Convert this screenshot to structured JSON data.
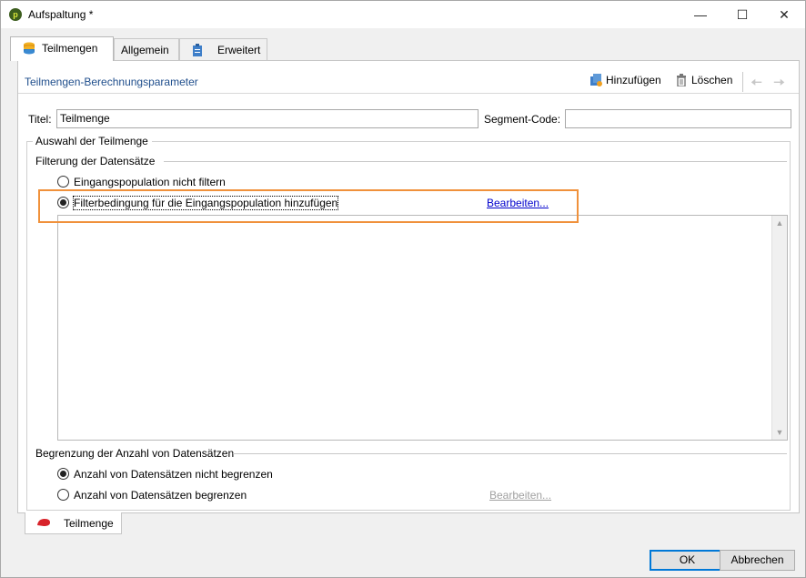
{
  "window": {
    "title": "Aufspaltung *"
  },
  "tabs": [
    {
      "label": "Teilmengen"
    },
    {
      "label": "Allgemein"
    },
    {
      "label": "Erweitert"
    }
  ],
  "toolbar": {
    "title": "Teilmengen-Berechnungsparameter",
    "add_label": "Hinzufügen",
    "delete_label": "Löschen"
  },
  "form": {
    "title_label": "Titel:",
    "title_value": "Teilmenge",
    "segment_label": "Segment-Code:",
    "segment_value": ""
  },
  "selection": {
    "group_title": "Auswahl der Teilmenge",
    "filter_section": "Filterung der Datensätze",
    "filter_options": [
      {
        "label": "Eingangspopulation nicht filtern",
        "checked": false
      },
      {
        "label": "Filterbedingung für die Eingangspopulation hinzufügen",
        "checked": true
      }
    ],
    "filter_edit_link": "Bearbeiten...",
    "limit_section": "Begrenzung der Anzahl von Datensätzen",
    "limit_options": [
      {
        "label": "Anzahl von Datensätzen nicht begrenzen",
        "checked": true
      },
      {
        "label": "Anzahl von Datensätzen begrenzen",
        "checked": false
      }
    ],
    "limit_edit_link": "Bearbeiten..."
  },
  "bottom_tab": {
    "label": "Teilmenge"
  },
  "buttons": {
    "ok": "OK",
    "cancel": "Abbrechen"
  },
  "colors": {
    "highlight": "#f0913b",
    "link": "#0000cc",
    "toolbar_title": "#1f4e8c",
    "primary_border": "#0078d7"
  }
}
